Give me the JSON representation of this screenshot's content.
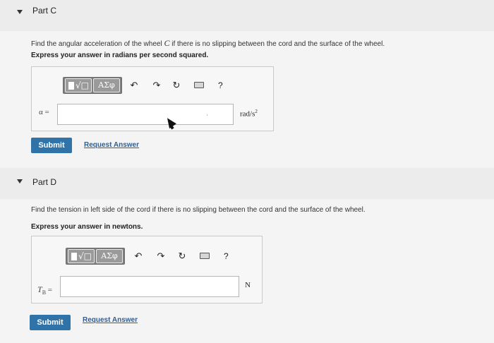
{
  "part_c": {
    "title": "Part C",
    "question_pre": "Find the angular acceleration of the wheel ",
    "question_var": "C",
    "question_post": " if there is no slipping between the cord and the surface of the wheel.",
    "instruction": "Express your answer in radians per second squared.",
    "toolbar": {
      "templates_label": "√□",
      "symbols_label": "ΑΣφ",
      "undo_icon": "undo-icon",
      "redo_icon": "redo-icon",
      "reset_icon": "reset-icon",
      "keyboard_icon": "keyboard-icon",
      "help_label": "?"
    },
    "var_label": "α =",
    "input_value": "",
    "unit_base": "rad/s",
    "unit_exp": "2",
    "submit_label": "Submit",
    "request_label": "Request Answer"
  },
  "part_d": {
    "title": "Part D",
    "question": "Find the tension in left side of the cord if there is no slipping between the cord and the surface of the wheel.",
    "instruction": "Express your answer in newtons.",
    "toolbar": {
      "templates_label": "√□",
      "symbols_label": "ΑΣφ",
      "help_label": "?"
    },
    "var_label_main": "T",
    "var_label_sub": "B",
    "var_label_eq": " =",
    "input_value": "",
    "unit": "N",
    "submit_label": "Submit",
    "request_label": "Request Answer"
  }
}
